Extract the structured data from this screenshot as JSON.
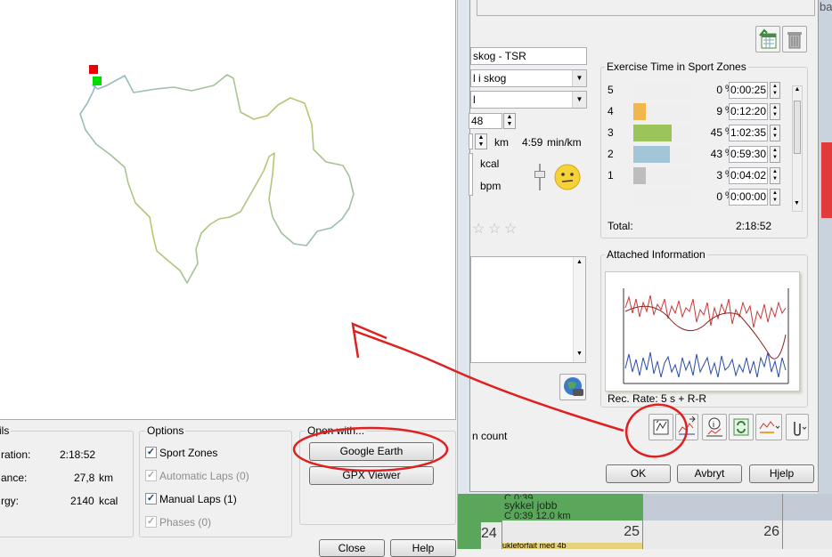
{
  "calendar": {
    "day_numbers": [
      "24",
      "25",
      "26"
    ],
    "entry_title": "sykkel jobb",
    "entry_detail": "C 0:39 12,0 km",
    "entry_top_partial": "C 0:39",
    "corner_text": "ba",
    "bottom_partial_text": "ukleforfait med 4b"
  },
  "map_window": {
    "details": {
      "title": "ils",
      "rows": [
        {
          "label": "ration:",
          "value": "2:18:52",
          "unit": ""
        },
        {
          "label": "ance:",
          "value": "27,8",
          "unit": "km"
        },
        {
          "label": "rgy:",
          "value": "2140",
          "unit": "kcal"
        }
      ]
    },
    "options": {
      "title": "Options",
      "items": [
        {
          "label": "Sport Zones",
          "checked": true,
          "disabled": false
        },
        {
          "label": "Automatic Laps (0)",
          "checked": true,
          "disabled": true
        },
        {
          "label": "Manual Laps (1)",
          "checked": true,
          "disabled": false
        },
        {
          "label": "Phases (0)",
          "checked": true,
          "disabled": true
        }
      ]
    },
    "open_with": {
      "title": "Open with...",
      "google_earth": "Google Earth",
      "gpx_viewer": "GPX Viewer"
    },
    "close_label": "Close",
    "help_label": "Help"
  },
  "exercise_dialog": {
    "name_field": "skog - TSR",
    "sport_select": "l i skog",
    "sub_select": "l",
    "number_field": "48",
    "distance_unit": "km",
    "pace_value": "4:59",
    "pace_unit": "min/km",
    "energy_unit": "kcal",
    "hr_unit": "bpm",
    "stars_count": 3,
    "count_label": "n count",
    "zones": {
      "title": "Exercise Time in Sport Zones",
      "rows": [
        {
          "zone": "5",
          "percent": 0,
          "time": "0:00:25",
          "color": "#e2604c"
        },
        {
          "zone": "4",
          "percent": 9,
          "time": "0:12:20",
          "color": "#f2b64f"
        },
        {
          "zone": "3",
          "percent": 45,
          "time": "1:02:35",
          "color": "#9bc55a"
        },
        {
          "zone": "2",
          "percent": 43,
          "time": "0:59:30",
          "color": "#a2c5d8"
        },
        {
          "zone": "1",
          "percent": 3,
          "time": "0:04:02",
          "color": "#bdbdbd"
        },
        {
          "zone": "",
          "percent": 0,
          "time": "0:00:00",
          "color": "#bdbdbd"
        }
      ],
      "pct_sign": "%",
      "total_label": "Total:",
      "total_value": "2:18:52"
    },
    "attached": {
      "title": "Attached Information",
      "rec_rate": "Rec. Rate: 5 s + R-R"
    },
    "ok_label": "OK",
    "cancel_label": "Avbryt",
    "help_label": "Hjelp"
  },
  "colors": {
    "annotation": "#e02020",
    "start_marker": "#00dd00",
    "end_marker": "#ee0000"
  }
}
